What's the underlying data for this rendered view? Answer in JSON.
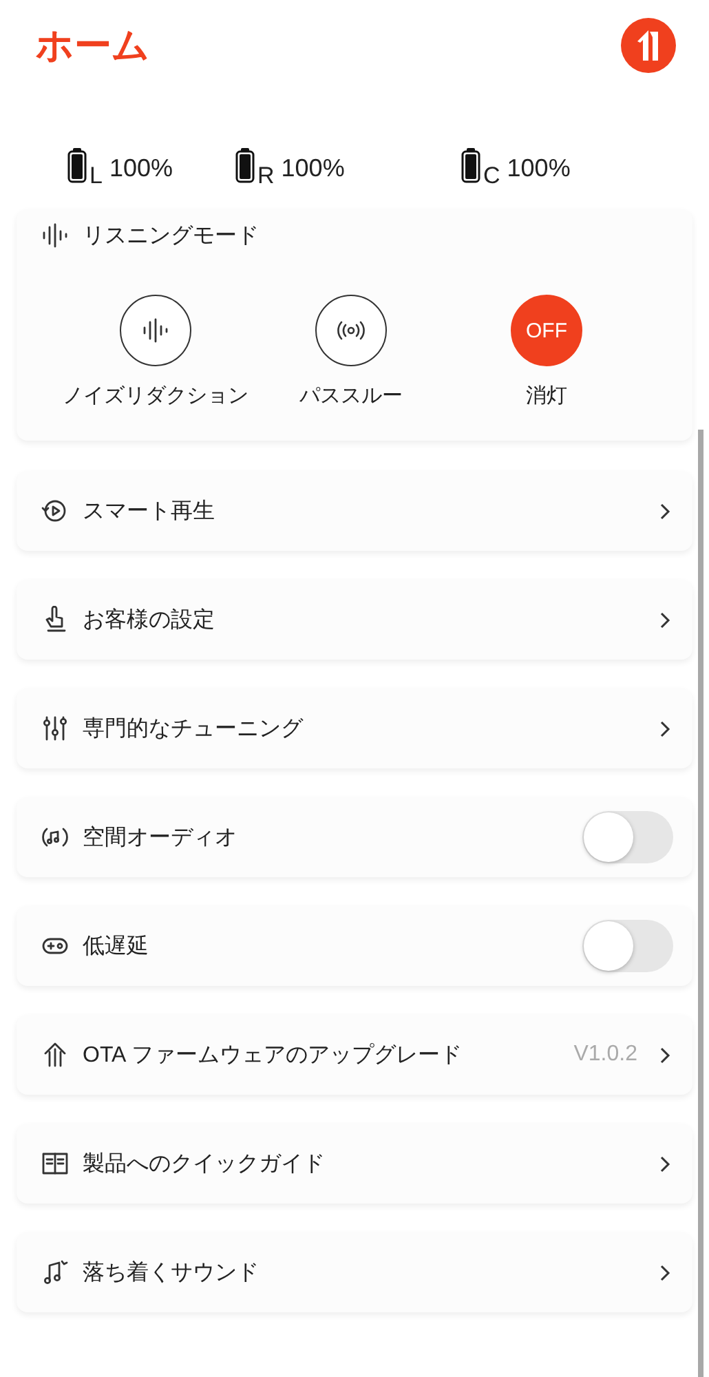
{
  "header": {
    "title": "ホーム"
  },
  "batteries": [
    {
      "side": "L",
      "percent": "100%"
    },
    {
      "side": "R",
      "percent": "100%"
    },
    {
      "side": "C",
      "percent": "100%"
    }
  ],
  "listening_mode": {
    "title": "リスニングモード",
    "modes": [
      {
        "kind": "noise",
        "label": "ノイズリダクション",
        "selected": false
      },
      {
        "kind": "passthrough",
        "label": "パススルー",
        "selected": false
      },
      {
        "kind": "off",
        "text": "OFF",
        "label": "消灯",
        "selected": true
      }
    ]
  },
  "rows": [
    {
      "kind": "link",
      "label": "スマート再生"
    },
    {
      "kind": "link",
      "label": "お客様の設定"
    },
    {
      "kind": "link",
      "label": "専門的なチューニング"
    },
    {
      "kind": "toggle",
      "label": "空間オーディオ",
      "on": false
    },
    {
      "kind": "toggle",
      "label": "低遅延",
      "on": false
    },
    {
      "kind": "link",
      "label": "OTA ファームウェアのアップグレード",
      "value": "V1.0.2"
    },
    {
      "kind": "link",
      "label": "製品へのクイックガイド"
    },
    {
      "kind": "link",
      "label": "落ち着くサウンド"
    }
  ]
}
